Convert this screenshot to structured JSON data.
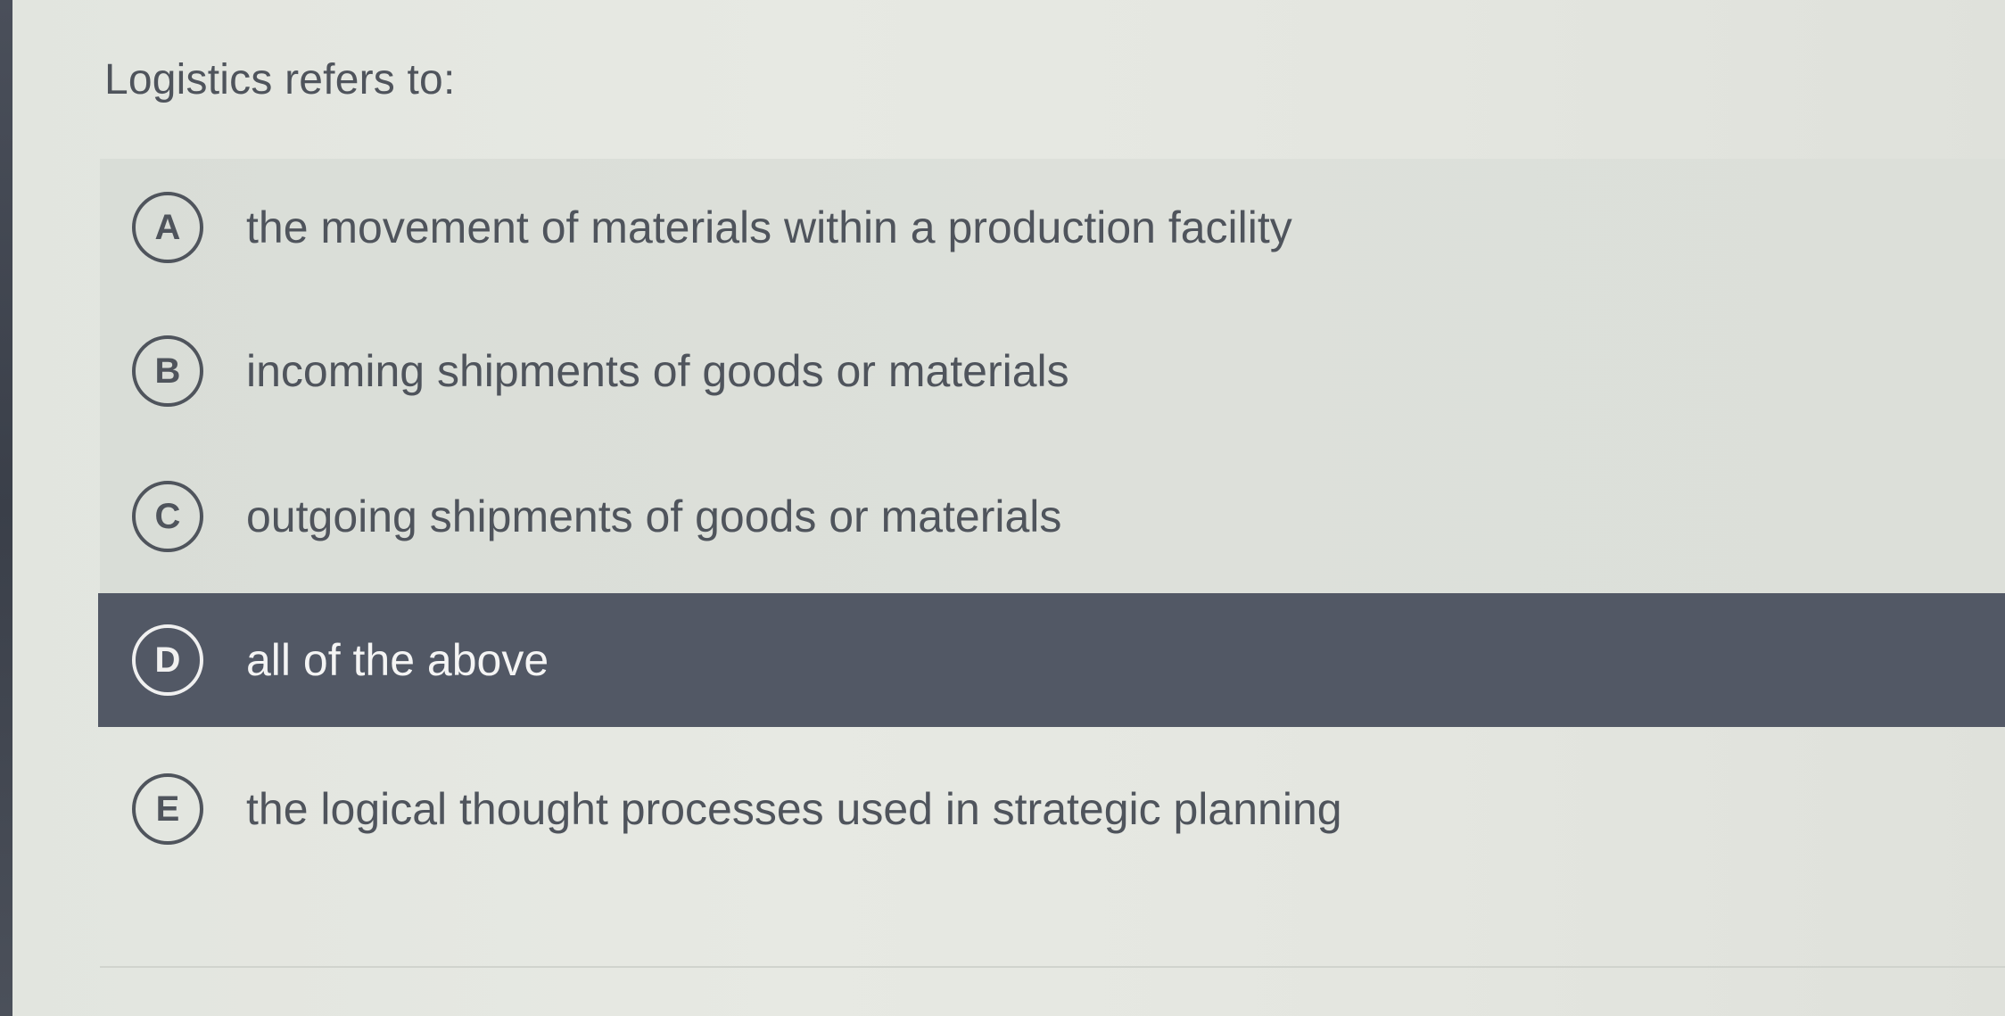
{
  "question": {
    "text": "Logistics refers to:"
  },
  "options": [
    {
      "letter": "A",
      "text": "the movement of materials within a production facility",
      "selected": false
    },
    {
      "letter": "B",
      "text": "incoming shipments of goods or materials",
      "selected": false
    },
    {
      "letter": "C",
      "text": "outgoing shipments of goods or materials",
      "selected": false
    },
    {
      "letter": "D",
      "text": "all of the above",
      "selected": true
    },
    {
      "letter": "E",
      "text": "the logical thought processes used in strategic planning",
      "selected": false
    }
  ],
  "colors": {
    "background": "#e4e6e0",
    "text": "#4f545c",
    "selected_background": "#525865",
    "selected_text": "#f4f4f4"
  }
}
